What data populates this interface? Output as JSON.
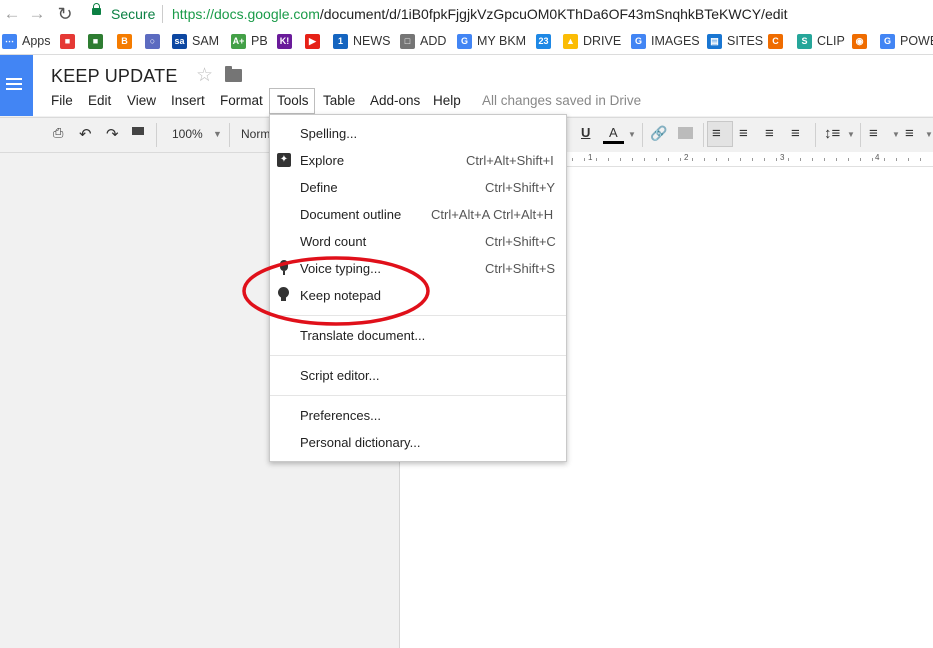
{
  "browser": {
    "secure_label": "Secure",
    "url_host": "https://docs.google.com",
    "url_path": "/document/d/1iB0fpkFjgjkVzGpcuOM0KThDa6OF43mSnqhkBTeKWCY/edit"
  },
  "bookmarks": [
    {
      "label": "Apps",
      "icon": "apps-grid-icon",
      "color": "#4285f4"
    },
    {
      "label": "",
      "icon": "chrome-store-icon",
      "color": "#e53935"
    },
    {
      "label": "",
      "icon": "contact-card-icon",
      "color": "#2e7d32"
    },
    {
      "label": "",
      "icon": "blogger-icon",
      "color": "#f57c00"
    },
    {
      "label": "",
      "icon": "globe-icon",
      "color": "#5c6bc0"
    },
    {
      "label": "SAM",
      "icon": "sam-icon",
      "color": "#0d47a1"
    },
    {
      "label": "PB",
      "icon": "aplus-icon",
      "color": "#43a047"
    },
    {
      "label": "",
      "icon": "kahoot-icon",
      "color": "#6a1b9a"
    },
    {
      "label": "",
      "icon": "youtube-icon",
      "color": "#e62117"
    },
    {
      "label": "NEWS",
      "icon": "news-icon",
      "color": "#1565c0"
    },
    {
      "label": "ADD",
      "icon": "page-icon",
      "color": "#757575"
    },
    {
      "label": "MY BKM",
      "icon": "google-icon",
      "color": "#4285f4"
    },
    {
      "label": "",
      "icon": "calendar-icon",
      "color": "#1e88e5"
    },
    {
      "label": "DRIVE",
      "icon": "drive-icon",
      "color": "#fbbc05"
    },
    {
      "label": "IMAGES",
      "icon": "google-icon",
      "color": "#4285f4"
    },
    {
      "label": "SITES",
      "icon": "sites-icon",
      "color": "#1976d2"
    },
    {
      "label": "",
      "icon": "orange-c-icon",
      "color": "#ef6c00"
    },
    {
      "label": "CLIP",
      "icon": "clip-icon",
      "color": "#26a69a"
    },
    {
      "label": "",
      "icon": "eye-icon",
      "color": "#ef6c00"
    },
    {
      "label": "POWE",
      "icon": "google-icon",
      "color": "#4285f4"
    }
  ],
  "doc": {
    "title": "KEEP UPDATE",
    "status": "All changes saved in Drive"
  },
  "menubar": [
    "File",
    "Edit",
    "View",
    "Insert",
    "Format",
    "Tools",
    "Table",
    "Add-ons",
    "Help"
  ],
  "toolbar": {
    "zoom": "100%",
    "style": "Norm"
  },
  "ruler": [
    "1",
    "2",
    "3",
    "4"
  ],
  "tools_menu": {
    "items": [
      {
        "label": "Spelling...",
        "shortcut": "",
        "icon": ""
      },
      {
        "label": "Explore",
        "shortcut": "Ctrl+Alt+Shift+I",
        "icon": "explore-icon"
      },
      {
        "label": "Define",
        "shortcut": "Ctrl+Shift+Y",
        "icon": ""
      },
      {
        "label": "Document outline",
        "shortcut": "Ctrl+Alt+A Ctrl+Alt+H",
        "icon": ""
      },
      {
        "label": "Word count",
        "shortcut": "Ctrl+Shift+C",
        "icon": ""
      },
      {
        "label": "Voice typing...",
        "shortcut": "Ctrl+Shift+S",
        "icon": "microphone-icon"
      },
      {
        "label": "Keep notepad",
        "shortcut": "",
        "icon": "lightbulb-icon"
      },
      {
        "label": "Translate document...",
        "shortcut": "",
        "icon": ""
      },
      {
        "label": "Script editor...",
        "shortcut": "",
        "icon": ""
      },
      {
        "label": "Preferences...",
        "shortcut": "",
        "icon": ""
      },
      {
        "label": "Personal dictionary...",
        "shortcut": "",
        "icon": ""
      }
    ]
  },
  "colors": {
    "docs_blue": "#4285f4",
    "secure_green": "#0b8043",
    "annotation_red": "#e0101a"
  }
}
